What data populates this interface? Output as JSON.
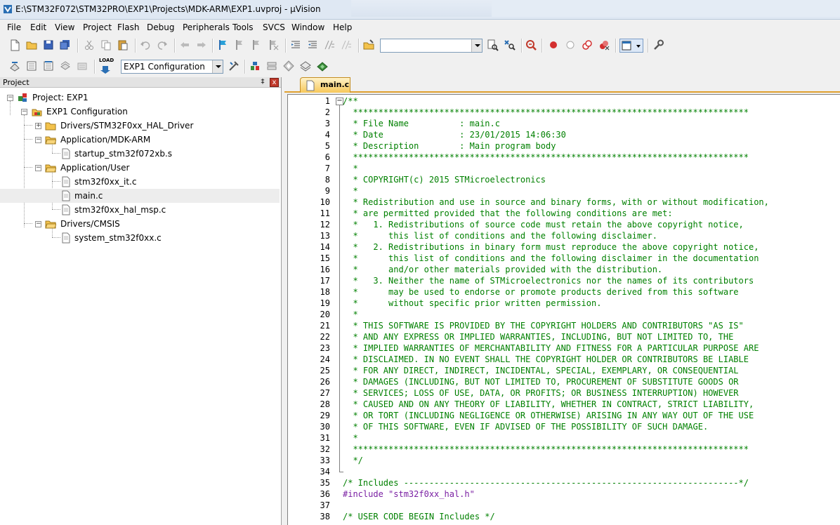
{
  "window": {
    "title": "E:\\STM32F072\\STM32PRO\\EXP1\\Projects\\MDK-ARM\\EXP1.uvproj - µVision"
  },
  "menu": [
    "File",
    "Edit",
    "View",
    "Project",
    "Flash",
    "Debug",
    "Peripherals",
    "Tools",
    "SVCS",
    "Window",
    "Help"
  ],
  "toolbar": {
    "find_combo_value": "",
    "target_combo_value": "EXP1 Configuration",
    "load_label": "LOAD"
  },
  "project_panel": {
    "title": "Project",
    "pin_glyph": "‡",
    "close_glyph": "x",
    "tree": [
      {
        "label": "Project: EXP1"
      },
      {
        "label": "EXP1 Configuration"
      },
      {
        "label": "Drivers/STM32F0xx_HAL_Driver"
      },
      {
        "label": "Application/MDK-ARM"
      },
      {
        "label": "startup_stm32f072xb.s"
      },
      {
        "label": "Application/User"
      },
      {
        "label": "stm32f0xx_it.c"
      },
      {
        "label": "main.c"
      },
      {
        "label": "stm32f0xx_hal_msp.c"
      },
      {
        "label": "Drivers/CMSIS"
      },
      {
        "label": "system_stm32f0xx.c"
      }
    ]
  },
  "editor": {
    "active_tab": "main.c",
    "lines": [
      {
        "n": "1",
        "text": "/**"
      },
      {
        "n": "2",
        "text": "  ******************************************************************************"
      },
      {
        "n": "3",
        "text": "  * File Name          : main.c"
      },
      {
        "n": "4",
        "text": "  * Date               : 23/01/2015 14:06:30"
      },
      {
        "n": "5",
        "text": "  * Description        : Main program body"
      },
      {
        "n": "6",
        "text": "  ******************************************************************************"
      },
      {
        "n": "7",
        "text": "  *"
      },
      {
        "n": "8",
        "text": "  * COPYRIGHT(c) 2015 STMicroelectronics"
      },
      {
        "n": "9",
        "text": "  *"
      },
      {
        "n": "10",
        "text": "  * Redistribution and use in source and binary forms, with or without modification,"
      },
      {
        "n": "11",
        "text": "  * are permitted provided that the following conditions are met:"
      },
      {
        "n": "12",
        "text": "  *   1. Redistributions of source code must retain the above copyright notice,"
      },
      {
        "n": "13",
        "text": "  *      this list of conditions and the following disclaimer."
      },
      {
        "n": "14",
        "text": "  *   2. Redistributions in binary form must reproduce the above copyright notice,"
      },
      {
        "n": "15",
        "text": "  *      this list of conditions and the following disclaimer in the documentation"
      },
      {
        "n": "16",
        "text": "  *      and/or other materials provided with the distribution."
      },
      {
        "n": "17",
        "text": "  *   3. Neither the name of STMicroelectronics nor the names of its contributors"
      },
      {
        "n": "18",
        "text": "  *      may be used to endorse or promote products derived from this software"
      },
      {
        "n": "19",
        "text": "  *      without specific prior written permission."
      },
      {
        "n": "20",
        "text": "  *"
      },
      {
        "n": "21",
        "text": "  * THIS SOFTWARE IS PROVIDED BY THE COPYRIGHT HOLDERS AND CONTRIBUTORS \"AS IS\""
      },
      {
        "n": "22",
        "text": "  * AND ANY EXPRESS OR IMPLIED WARRANTIES, INCLUDING, BUT NOT LIMITED TO, THE"
      },
      {
        "n": "23",
        "text": "  * IMPLIED WARRANTIES OF MERCHANTABILITY AND FITNESS FOR A PARTICULAR PURPOSE ARE"
      },
      {
        "n": "24",
        "text": "  * DISCLAIMED. IN NO EVENT SHALL THE COPYRIGHT HOLDER OR CONTRIBUTORS BE LIABLE"
      },
      {
        "n": "25",
        "text": "  * FOR ANY DIRECT, INDIRECT, INCIDENTAL, SPECIAL, EXEMPLARY, OR CONSEQUENTIAL"
      },
      {
        "n": "26",
        "text": "  * DAMAGES (INCLUDING, BUT NOT LIMITED TO, PROCUREMENT OF SUBSTITUTE GOODS OR"
      },
      {
        "n": "27",
        "text": "  * SERVICES; LOSS OF USE, DATA, OR PROFITS; OR BUSINESS INTERRUPTION) HOWEVER"
      },
      {
        "n": "28",
        "text": "  * CAUSED AND ON ANY THEORY OF LIABILITY, WHETHER IN CONTRACT, STRICT LIABILITY,"
      },
      {
        "n": "29",
        "text": "  * OR TORT (INCLUDING NEGLIGENCE OR OTHERWISE) ARISING IN ANY WAY OUT OF THE USE"
      },
      {
        "n": "30",
        "text": "  * OF THIS SOFTWARE, EVEN IF ADVISED OF THE POSSIBILITY OF SUCH DAMAGE."
      },
      {
        "n": "31",
        "text": "  *"
      },
      {
        "n": "32",
        "text": "  ******************************************************************************"
      },
      {
        "n": "33",
        "text": "  */"
      },
      {
        "n": "34",
        "text": ""
      },
      {
        "n": "35",
        "text": "/* Includes ------------------------------------------------------------------*/"
      },
      {
        "n": "36",
        "text": "#include \"stm32f0xx_hal.h\""
      },
      {
        "n": "37",
        "text": ""
      },
      {
        "n": "38",
        "text": "/* USER CODE BEGIN Includes */"
      }
    ]
  },
  "colors": {
    "comment": "#008000",
    "preprocessor": "#7a1fa3",
    "tab_active": "#f7c85a"
  }
}
